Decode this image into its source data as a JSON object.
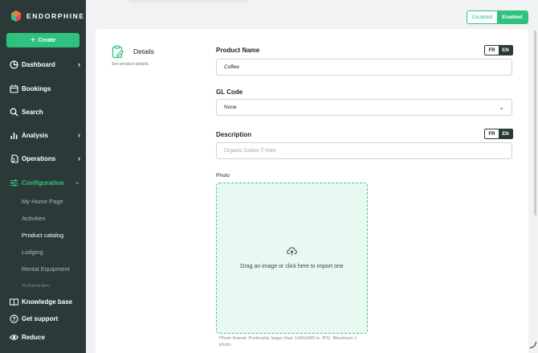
{
  "brand": {
    "name": "ENDORPHINE",
    "colors": {
      "accent": "#2ec27e",
      "sidebar": "#2b3a38"
    }
  },
  "sidebar": {
    "create_label": "Create",
    "items": [
      {
        "label": "Dashboard",
        "icon": "dashboard-icon",
        "chevron": true
      },
      {
        "label": "Bookings",
        "icon": "calendar-icon",
        "chevron": false
      },
      {
        "label": "Search",
        "icon": "search-icon",
        "chevron": false
      },
      {
        "label": "Analysis",
        "icon": "bar-chart-icon",
        "chevron": true
      },
      {
        "label": "Operations",
        "icon": "operations-icon",
        "chevron": true
      },
      {
        "label": "Configuration",
        "icon": "sliders-icon",
        "chevron": true,
        "active": true
      }
    ],
    "sub_items": [
      "My Home Page",
      "Activities",
      "Product catalog",
      "Lodging",
      "Rental Equipment",
      "Schedules"
    ],
    "active_sub": "Product catalog",
    "footer": [
      {
        "label": "Knowledge base",
        "icon": "book-icon"
      },
      {
        "label": "Get support",
        "icon": "help-icon"
      },
      {
        "label": "Reduce",
        "icon": "eye-icon"
      }
    ]
  },
  "status_toggle": {
    "off_label": "Disabled",
    "on_label": "Enabled",
    "selected": "Enabled"
  },
  "details": {
    "title": "Details",
    "subtitle": "Set product details."
  },
  "form": {
    "product_name": {
      "label": "Product Name",
      "value": "Coffee",
      "lang_fr": "FR",
      "lang_en": "EN"
    },
    "gl_code": {
      "label": "GL Code",
      "value": "None"
    },
    "description": {
      "label": "Description",
      "placeholder": "Organic Cotton T-Shirt",
      "lang_fr": "FR",
      "lang_en": "EN"
    },
    "photo": {
      "label": "Photo",
      "drop_text": "Drag an image or click here to import one",
      "hint": "Photo format: Preferably larger than 1440x960 in JPG. Maximum 1 photo."
    }
  }
}
